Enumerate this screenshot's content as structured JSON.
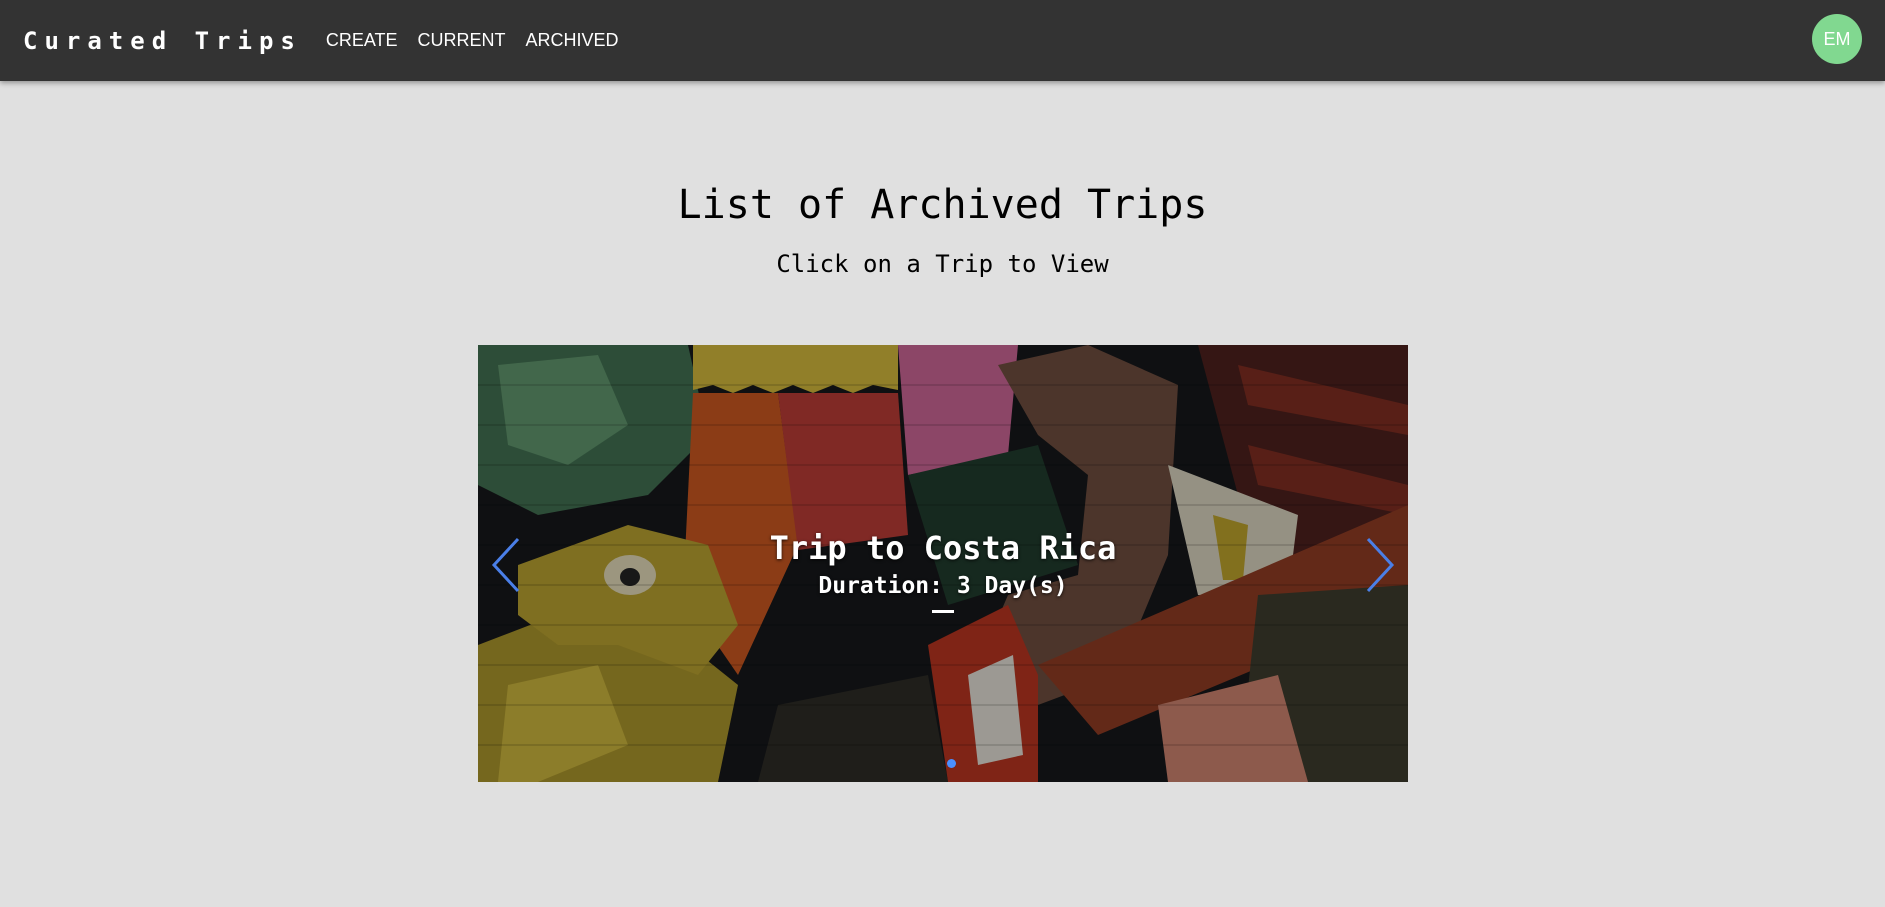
{
  "navbar": {
    "brand": "Curated Trips",
    "links": [
      {
        "label": "CREATE"
      },
      {
        "label": "CURRENT"
      },
      {
        "label": "ARCHIVED"
      }
    ],
    "avatar_initials": "EM",
    "avatar_color": "#81d890",
    "background_color": "#333333"
  },
  "main": {
    "title": "List of Archived Trips",
    "subtitle": "Click on a Trip to View"
  },
  "carousel": {
    "slides": [
      {
        "title": "Trip to Costa Rica",
        "duration": "Duration: 3 Day(s)"
      }
    ],
    "active_index": 0,
    "prev_icon": "chevron-left-icon",
    "next_icon": "chevron-right-icon",
    "accent_color": "#4a90ff"
  }
}
